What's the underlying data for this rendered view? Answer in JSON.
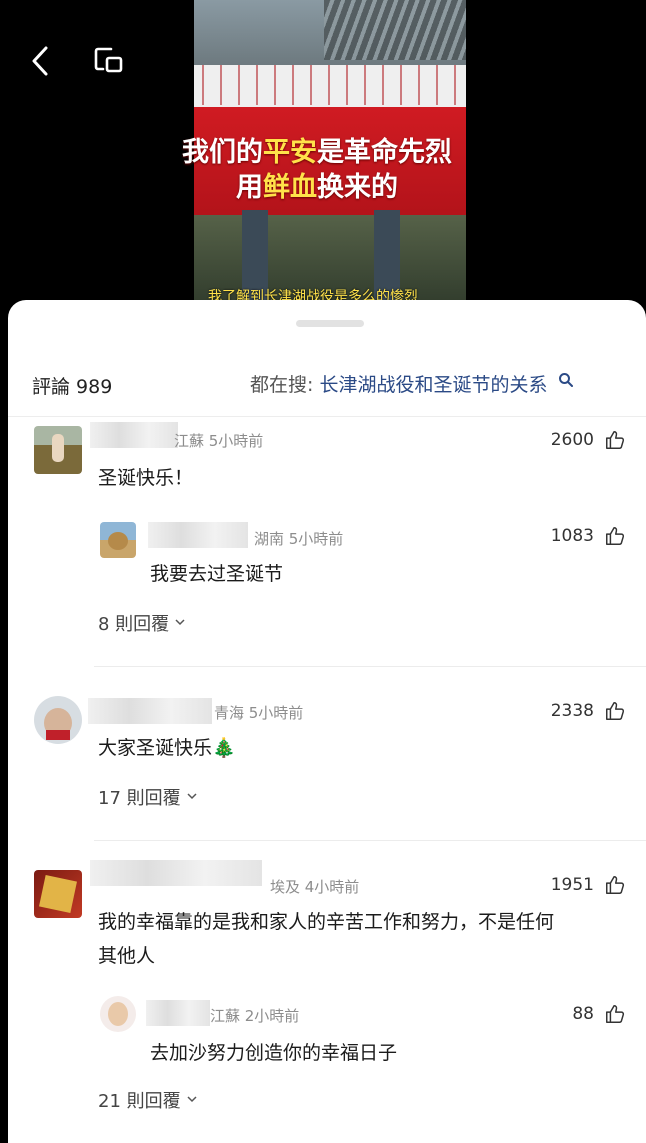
{
  "video": {
    "line1_white": "我们的",
    "line1_yellow": "平安",
    "line1_rest": "是革命先烈",
    "line2_a": "用",
    "line2_yellow": "鲜血",
    "line2_b": "换来的",
    "subtitle": "我了解到长津湖战役是多么的惨烈"
  },
  "panel": {
    "count_label": "評論 989",
    "search_prefix": "都在搜:",
    "search_query": "长津湖战役和圣诞节的关系"
  },
  "comments": [
    {
      "meta": "江蘇 5小時前",
      "likes": "2600",
      "text": "圣诞快乐！",
      "reply": {
        "meta": "湖南 5小時前",
        "likes": "1083",
        "text": "我要去过圣诞节"
      },
      "replies_label": "8 則回覆"
    },
    {
      "meta": "青海 5小時前",
      "likes": "2338",
      "text": "大家圣诞快乐🎄",
      "replies_label": "17 則回覆"
    },
    {
      "meta": "埃及 4小時前",
      "likes": "1951",
      "text_line1": "我的幸福靠的是我和家人的辛苦工作和努力，不是任何",
      "text_line2": "其他人",
      "reply": {
        "meta": "江蘇 2小時前",
        "likes": "88",
        "text": "去加沙努力创造你的幸福日子"
      },
      "replies_label": "21 則回覆"
    }
  ],
  "icons": [
    "back-arrow-icon",
    "window-icon",
    "search-icon",
    "thumbs-up-icon",
    "chevron-down-icon"
  ],
  "colors": {
    "accent_link": "#2b4a86",
    "banner_red": "#c7141c",
    "subtitle_yellow": "#ffe24a"
  }
}
